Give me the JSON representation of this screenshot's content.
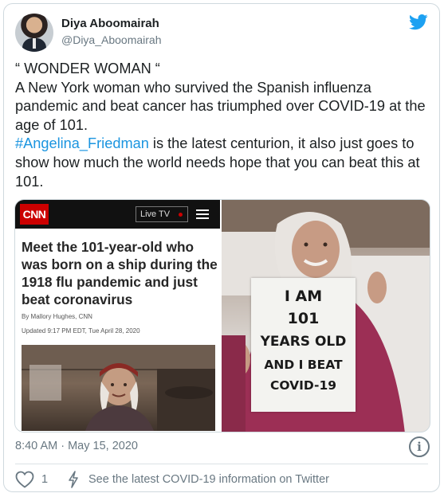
{
  "author": {
    "name": "Diya Aboomairah",
    "handle": "@Diya_Aboomairah"
  },
  "tweet": {
    "line1": "“ WONDER WOMAN “",
    "line2": "A New York woman who survived the Spanish influenza pandemic and beat cancer has triumphed over COVID-19 at the age of 101.",
    "hashtag": "#Angelina_Friedman",
    "line3_rest": " is the latest centurion, it also just goes to show how much the world needs hope that you can beat this at 101."
  },
  "cnn": {
    "logo": "CNN",
    "live_tv": "Live TV",
    "headline": "Meet the 101-year-old who was born on a ship during the 1918 flu pandemic and just beat coronavirus",
    "byline": "By Mallory Hughes, CNN",
    "updated": "Updated 9:17 PM EDT, Tue April 28, 2020"
  },
  "sign": {
    "line1": "I AM",
    "line2": "101",
    "line3": "YEARS OLD",
    "line4": "AND I BEAT",
    "line5": "COVID-19"
  },
  "footer": {
    "timestamp": "8:40 AM · May 15, 2020",
    "likes": "1",
    "covid_link": "See the latest COVID-19 information on Twitter",
    "info_glyph": "i"
  },
  "colors": {
    "link": "#1b95e0",
    "twitter_blue": "#1da1f2",
    "muted": "#697882",
    "cnn_red": "#cc0000"
  },
  "icons": [
    "twitter-bird-icon",
    "info-icon",
    "heart-icon",
    "lightning-icon",
    "menu-icon"
  ]
}
